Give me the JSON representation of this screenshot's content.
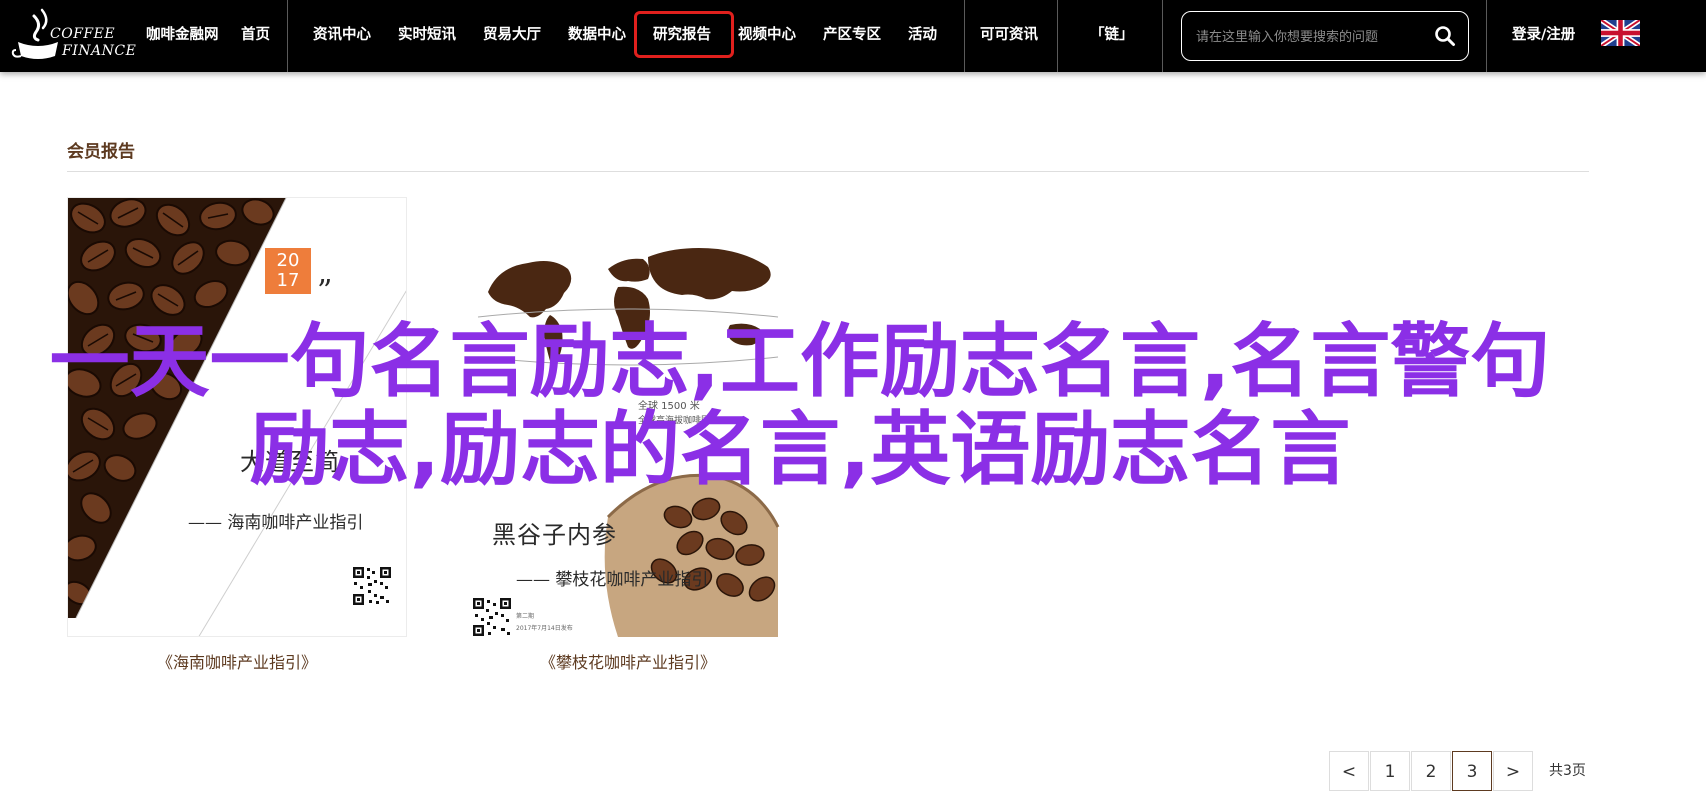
{
  "header": {
    "logo": {
      "line1": "COFFEE",
      "line2": "FINANCE"
    },
    "nav": [
      {
        "label": "咖啡金融网"
      },
      {
        "label": "首页"
      },
      {
        "label": "资讯中心"
      },
      {
        "label": "实时短讯"
      },
      {
        "label": "贸易大厅"
      },
      {
        "label": "数据中心"
      },
      {
        "label": "研究报告",
        "active": true
      },
      {
        "label": "视频中心"
      },
      {
        "label": "产区专区"
      },
      {
        "label": "活动"
      },
      {
        "label": "可可资讯"
      },
      {
        "label": "「链」"
      }
    ],
    "search": {
      "placeholder": "请在这里输入你想要搜索的问题"
    },
    "login_label": "登录/注册",
    "highlight_color": "#e0201d"
  },
  "section": {
    "title": "会员报告"
  },
  "reports": [
    {
      "caption": "《海南咖啡产业指引》",
      "cover": {
        "year_top": "20",
        "year_bottom": "17",
        "quote_mark": "”",
        "title": "大道至简",
        "subtitle": "—— 海南咖啡产业指引"
      }
    },
    {
      "caption": "《攀枝花咖啡产业指引》",
      "cover": {
        "title": "黑谷子内参",
        "subtitle": "—— 攀枝花咖啡产业指引",
        "map_label1": "全球 1500 米",
        "map_label2": "全球高海拔咖啡区",
        "footer_line1": "第二期",
        "footer_line2": "2017年7月14日发布"
      }
    }
  ],
  "overlay": {
    "text": "一天一句名言励志,工作励志名言,名言警句 励志,励志的名言,英语励志名言",
    "color": "#8b2fe6"
  },
  "pagination": {
    "prev": "<",
    "pages": [
      "1",
      "2",
      "3"
    ],
    "current": "3",
    "next": ">",
    "total": "共3页"
  },
  "colors": {
    "accent_brown": "#5d3a20",
    "cover_orange": "#ee7d3b"
  },
  "icons": [
    "coffee-cup-logo-icon",
    "search-icon",
    "uk-flag-icon"
  ]
}
